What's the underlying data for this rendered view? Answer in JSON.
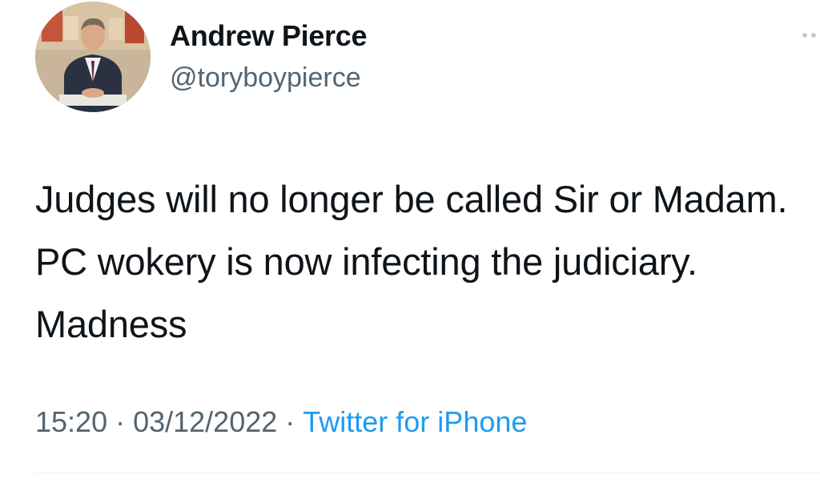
{
  "author": {
    "display_name": "Andrew Pierce",
    "handle": "@toryboypierce"
  },
  "tweet": {
    "text": "Judges will no longer be called Sir or Madam. PC wokery is now infecting the judiciary. Madness",
    "time": "15:20",
    "date": "03/12/2022",
    "separator": "·",
    "source": "Twitter for iPhone"
  },
  "colors": {
    "primary_text": "#0f1419",
    "secondary_text": "#536471",
    "link": "#1d9bf0"
  },
  "icons": {
    "more": "more-options-icon"
  }
}
